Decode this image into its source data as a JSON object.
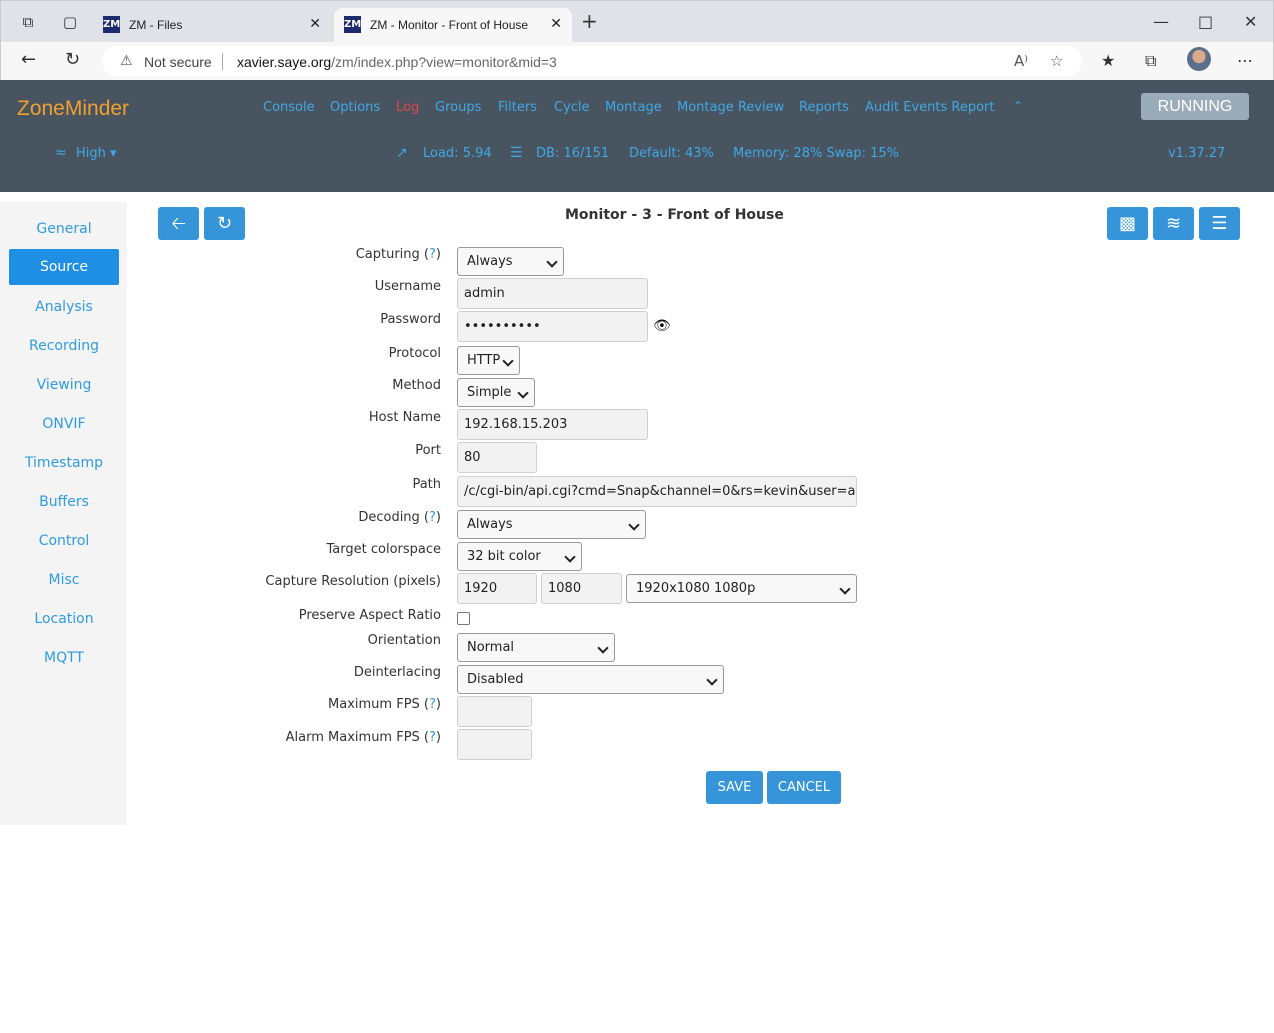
{
  "browser": {
    "tabs": [
      {
        "favicon": "ZM",
        "title": "ZM - Files"
      },
      {
        "favicon": "ZM",
        "title": "ZM - Monitor - Front of House"
      }
    ],
    "security_label": "Not secure",
    "url_host": "xavier.saye.org",
    "url_path": "/zm/index.php?view=monitor&mid=3"
  },
  "app": {
    "brand": "ZoneMinder",
    "nav": [
      "Console",
      "Options",
      "Log",
      "Groups",
      "Filters",
      "Cycle",
      "Montage",
      "Montage Review",
      "Reports",
      "Audit Events Report"
    ],
    "status": "RUNNING",
    "bandwidth": "High",
    "load": "Load: 5.94",
    "db": "DB: 16/151",
    "default": "Default: 43%",
    "memory": "Memory: 28% Swap: 15%",
    "version": "v1.37.27",
    "accent_color": "#3fa8e6",
    "brand_color": "#f0a030",
    "log_color": "#e0474c"
  },
  "sidebar": {
    "items": [
      "General",
      "Source",
      "Analysis",
      "Recording",
      "Viewing",
      "ONVIF",
      "Timestamp",
      "Buffers",
      "Control",
      "Misc",
      "Location",
      "MQTT"
    ],
    "active": "Source"
  },
  "page": {
    "title": "Monitor - 3 - Front of House"
  },
  "form": {
    "capturing": {
      "label": "Capturing",
      "help": "?",
      "value": "Always"
    },
    "username": {
      "label": "Username",
      "value": "admin"
    },
    "password": {
      "label": "Password",
      "value": "••••••••••"
    },
    "protocol": {
      "label": "Protocol",
      "value": "HTTP"
    },
    "method": {
      "label": "Method",
      "value": "Simple"
    },
    "host_name": {
      "label": "Host Name",
      "value": "192.168.15.203"
    },
    "port": {
      "label": "Port",
      "value": "80"
    },
    "path": {
      "label": "Path",
      "value": "/c/cgi-bin/api.cgi?cmd=Snap&channel=0&rs=kevin&user=a"
    },
    "decoding": {
      "label": "Decoding",
      "help": "?",
      "value": "Always"
    },
    "target_colorspace": {
      "label": "Target colorspace",
      "value": "32 bit color"
    },
    "capture_resolution": {
      "label": "Capture Resolution (pixels)",
      "width": "1920",
      "height": "1080",
      "preset": "1920x1080 1080p"
    },
    "preserve_aspect": {
      "label": "Preserve Aspect Ratio",
      "checked": false
    },
    "orientation": {
      "label": "Orientation",
      "value": "Normal"
    },
    "deinterlacing": {
      "label": "Deinterlacing",
      "value": "Disabled"
    },
    "max_fps": {
      "label": "Maximum FPS",
      "help": "?",
      "value": ""
    },
    "alarm_max_fps": {
      "label": "Alarm Maximum FPS",
      "help": "?",
      "value": ""
    },
    "save_label": "SAVE",
    "cancel_label": "CANCEL"
  }
}
